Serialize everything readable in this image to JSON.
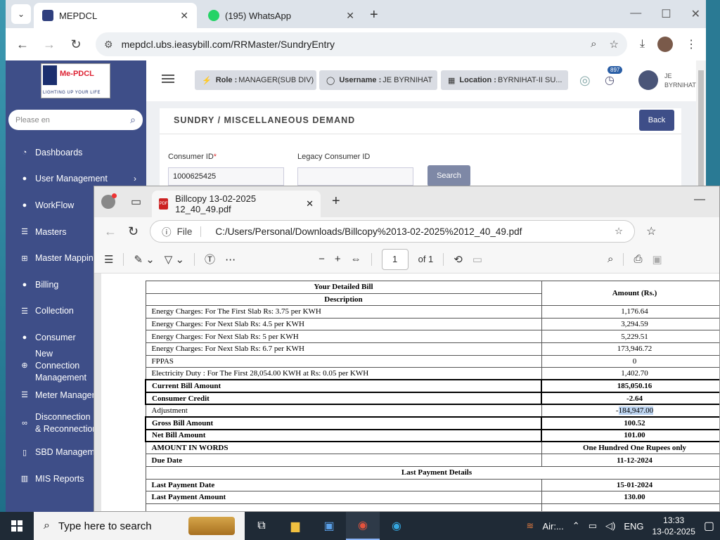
{
  "chrome": {
    "tab_active_title": "MEPDCL",
    "tab_inactive_title": "(195) WhatsApp",
    "url": "mepdcl.ubs.ieasybill.com/RRMaster/SundryEntry"
  },
  "mepdcl": {
    "logo_text": "Me-PDCL",
    "logo_tagline": "LIGHTING UP YOUR LIFE",
    "search_placeholder": "Please en",
    "menu": [
      {
        "label": "Dashboards",
        "icon": "dashboard-icon"
      },
      {
        "label": "User Management",
        "icon": "user-icon"
      },
      {
        "label": "WorkFlow",
        "icon": "user-icon"
      },
      {
        "label": "Masters",
        "icon": "list-icon"
      },
      {
        "label": "Master Mapping",
        "icon": "sitemap-icon"
      },
      {
        "label": "Billing",
        "icon": "user-icon"
      },
      {
        "label": "Collection",
        "icon": "list-icon"
      },
      {
        "label": "Consumer",
        "icon": "user-icon"
      },
      {
        "label": "New Connection Management",
        "icon": "plus-icon"
      },
      {
        "label": "Meter Managem",
        "icon": "list-icon"
      },
      {
        "label": "Disconnection & Reconnection",
        "icon": "link-icon"
      },
      {
        "label": "SBD Manageme",
        "icon": "phone-icon"
      },
      {
        "label": "MIS Reports",
        "icon": "chart-icon"
      }
    ],
    "role_label": "Role :",
    "role_value": "MANAGER(SUB DIV)",
    "username_label": "Username :",
    "username_value": "JE BYRNIHAT",
    "location_label": "Location :",
    "location_value": "BYRNIHAT-II SU...",
    "notif_count": "897",
    "user_display_line1": "JE",
    "user_display_line2": "BYRNIHAT",
    "card_title": "SUNDRY / MISCELLANEOUS DEMAND",
    "back_label": "Back",
    "consumer_id_label": "Consumer ID",
    "consumer_id_value": "1000625425",
    "legacy_label": "Legacy Consumer ID",
    "legacy_value": "",
    "search_label": "Search"
  },
  "edge": {
    "tab_title": "Billcopy 13-02-2025 12_40_49.pdf",
    "file_label": "File",
    "path": "C:/Users/Personal/Downloads/Billcopy%2013-02-2025%2012_40_49.pdf",
    "page_current": "1",
    "page_total": "of 1"
  },
  "bill": {
    "header_title": "Your Detailed Bill",
    "header_desc": "Description",
    "header_amount": "Amount (Rs.)",
    "rows": [
      {
        "desc": "Energy Charges: For The First Slab Rs: 3.75 per KWH",
        "amount": "1,176.64",
        "bold": false
      },
      {
        "desc": "Energy Charges: For Next Slab Rs: 4.5 per KWH",
        "amount": "3,294.59",
        "bold": false
      },
      {
        "desc": "Energy Charges: For Next Slab Rs: 5 per KWH",
        "amount": "5,229.51",
        "bold": false
      },
      {
        "desc": "Energy Charges: For Next Slab Rs: 6.7 per KWH",
        "amount": "173,946.72",
        "bold": false
      },
      {
        "desc": "FPPAS",
        "amount": "0",
        "bold": false
      },
      {
        "desc": "Electricity Duty : For The First 28,054.00 KWH at Rs: 0.05 per KWH",
        "amount": "1,402.70",
        "bold": false
      },
      {
        "desc": "Current Bill Amount",
        "amount": "185,050.16",
        "bold": true
      },
      {
        "desc": "Consumer Credit",
        "amount": "-2.64",
        "bold": true
      }
    ],
    "adjustment_label": "Adjustment",
    "adjustment_sign": "-",
    "adjustment_value": "184,947.00",
    "rows2": [
      {
        "desc": "Gross Bill Amount",
        "amount": "100.52"
      },
      {
        "desc": "Net Bill Amount",
        "amount": "101.00"
      }
    ],
    "words_label": "AMOUNT IN WORDS",
    "words_value": "One Hundred One Rupees only",
    "due_label": "Due Date",
    "due_value": "11-12-2024",
    "last_payment_header": "Last Payment Details",
    "last_date_label": "Last Payment Date",
    "last_date_value": "15-01-2024",
    "last_amount_label": "Last Payment Amount",
    "last_amount_value": "130.00"
  },
  "taskbar": {
    "search_placeholder": "Type here to search",
    "weather_app": "Air:...",
    "lang": "ENG",
    "time": "13:33",
    "date": "13-02-2025"
  }
}
